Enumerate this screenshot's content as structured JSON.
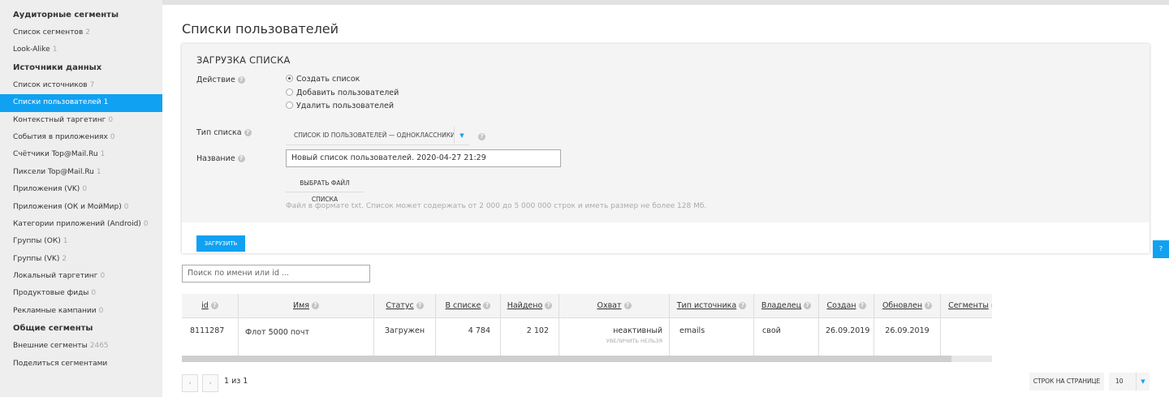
{
  "sidebar": {
    "groups": [
      {
        "heading": "Аудиторные сегменты",
        "items": [
          {
            "label": "Список сегментов",
            "count": "2"
          },
          {
            "label": "Look-Alike",
            "count": "1"
          }
        ]
      },
      {
        "heading": "Источники данных",
        "items": [
          {
            "label": "Список источников",
            "count": "7"
          },
          {
            "label": "Списки пользователей",
            "count": "1",
            "active": true
          },
          {
            "label": "Контекстный таргетинг",
            "count": "0"
          },
          {
            "label": "События в приложениях",
            "count": "0"
          },
          {
            "label": "Счётчики Top@Mail.Ru",
            "count": "1"
          },
          {
            "label": "Пиксели Top@Mail.Ru",
            "count": "1"
          },
          {
            "label": "Приложения (VK)",
            "count": "0"
          },
          {
            "label": "Приложения (ОК и МойМир)",
            "count": "0"
          },
          {
            "label": "Категории приложений (Android)",
            "count": "0"
          },
          {
            "label": "Группы (ОК)",
            "count": "1"
          },
          {
            "label": "Группы (VK)",
            "count": "2"
          },
          {
            "label": "Локальный таргетинг",
            "count": "0"
          },
          {
            "label": "Продуктовые фиды",
            "count": "0"
          },
          {
            "label": "Рекламные кампании",
            "count": "0"
          }
        ]
      },
      {
        "heading": "Общие сегменты",
        "items": [
          {
            "label": "Внешние сегменты",
            "count": "2465"
          },
          {
            "label": "Поделиться сегментами",
            "count": ""
          }
        ]
      }
    ]
  },
  "page": {
    "title": "Списки пользователей"
  },
  "upload": {
    "title": "ЗАГРУЗКА СПИСКА",
    "action_label": "Действие",
    "actions": [
      {
        "label": "Создать список",
        "selected": true
      },
      {
        "label": "Добавить пользователей",
        "selected": false
      },
      {
        "label": "Удалить пользователей",
        "selected": false
      }
    ],
    "list_type_label": "Тип списка",
    "list_type_value": "СПИСОК ID ПОЛЬЗОВАТЕЛЕЙ — ОДНОКЛАССНИКИ",
    "name_label": "Название",
    "name_value": "Новый список пользователей. 2020-04-27 21:29",
    "file_button": "ВЫБРАТЬ ФАЙЛ СПИСКА",
    "hint": "Файл в формате txt. Список может содержать от 2 000 до 5 000 000 строк и иметь размер не более 128 Мб.",
    "submit": "ЗАГРУЗИТЬ"
  },
  "help_badge": "?",
  "search": {
    "placeholder": "Поиск по имени или id ..."
  },
  "table": {
    "columns": [
      "id",
      "Имя",
      "Статус",
      "В списке",
      "Найдено",
      "Охват",
      "Тип источника",
      "Владелец",
      "Создан",
      "Обновлен",
      "Сегменты"
    ],
    "rows": [
      {
        "id": "8111287",
        "name": "Флот 5000 почт",
        "status": "Загружен",
        "in_list": "4 784",
        "found": "2 102",
        "reach": "неактивный",
        "reach_note": "УВЕЛИЧИТЬ НЕЛЬЗЯ",
        "source_type": "emails",
        "owner": "свой",
        "created": "26.09.2019",
        "updated": "26.09.2019",
        "segments": ""
      }
    ]
  },
  "pager": {
    "prev": "‹",
    "next": "›",
    "text": "1 из 1",
    "rows_label": "СТРОК НА СТРАНИЦЕ",
    "rows_value": "10"
  },
  "icons": {
    "help": "question-circle-icon",
    "dropdown": "triangle-down-icon"
  },
  "colors": {
    "accent": "#11a1f2"
  }
}
